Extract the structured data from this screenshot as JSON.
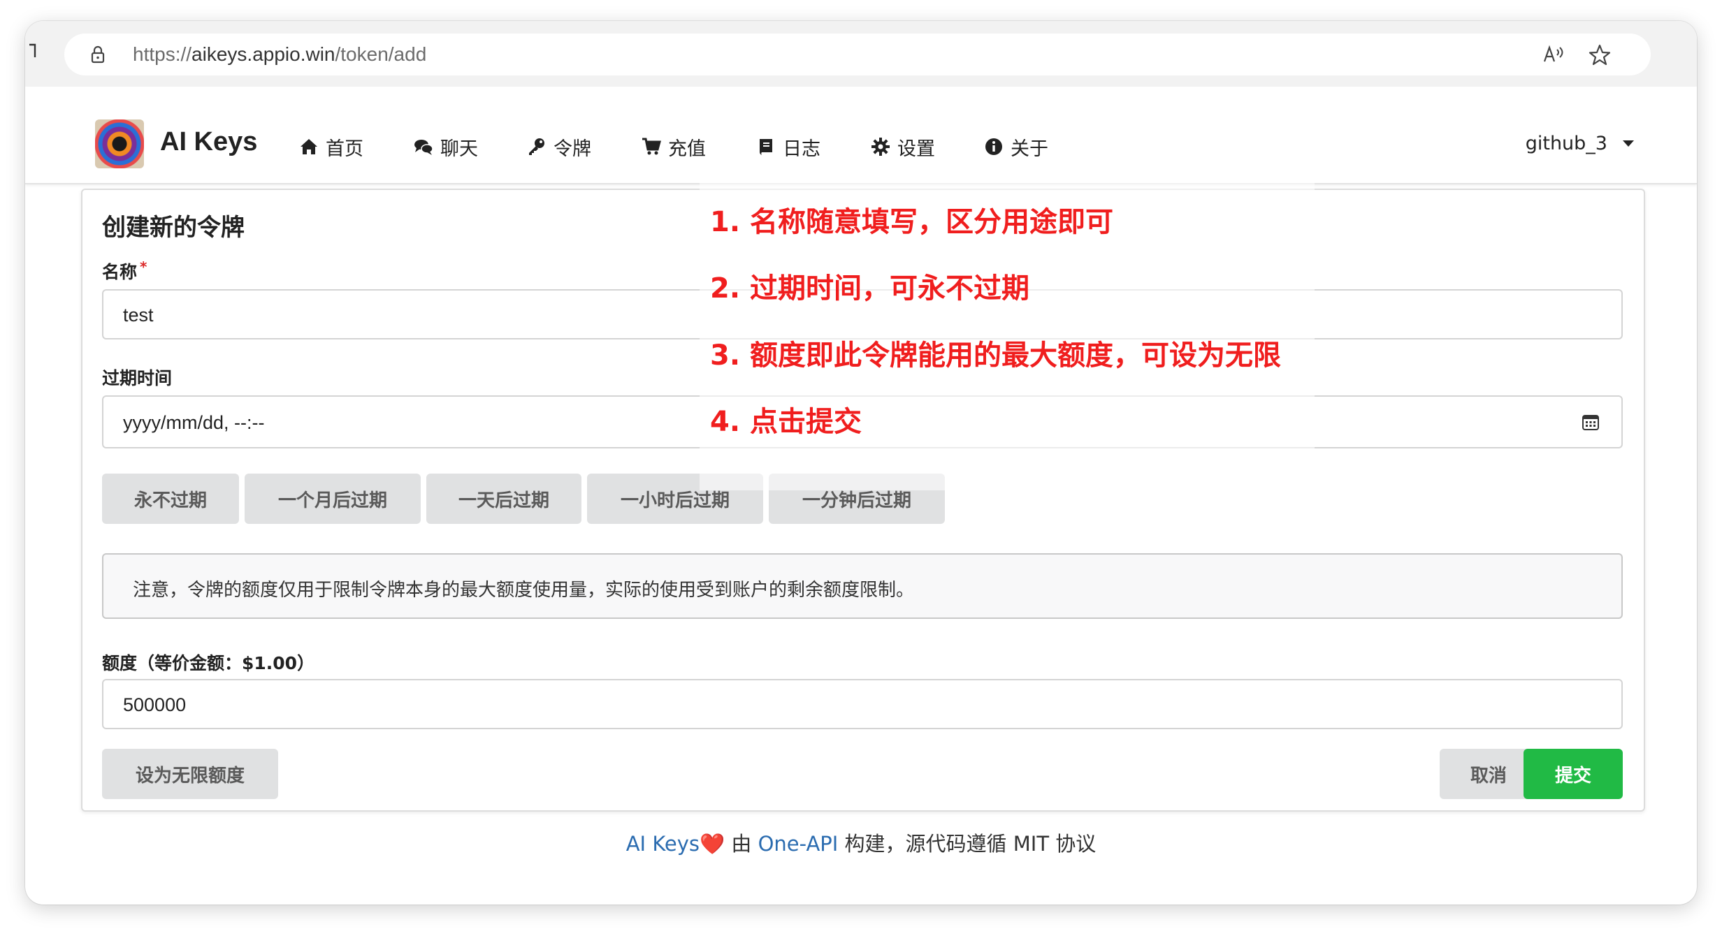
{
  "browser": {
    "url_prefix": "https://",
    "url_domain": "aikeys.appio.win",
    "url_path": "/token/add"
  },
  "nav": {
    "brand": "AI Keys",
    "items": [
      {
        "label": "首页",
        "icon": "home-icon"
      },
      {
        "label": "聊天",
        "icon": "comments-icon"
      },
      {
        "label": "令牌",
        "icon": "key-icon"
      },
      {
        "label": "充值",
        "icon": "cart-icon"
      },
      {
        "label": "日志",
        "icon": "book-icon"
      },
      {
        "label": "设置",
        "icon": "gear-icon"
      },
      {
        "label": "关于",
        "icon": "info-icon"
      }
    ],
    "user": "github_3"
  },
  "form": {
    "title": "创建新的令牌",
    "name_label": "名称",
    "required_mark": "*",
    "name_value": "test",
    "expire_label": "过期时间",
    "expire_value": "yyyy/mm/dd, --:--",
    "expire_buttons": [
      "永不过期",
      "一个月后过期",
      "一天后过期",
      "一小时后过期",
      "一分钟后过期"
    ],
    "notice": "注意，令牌的额度仅用于限制令牌本身的最大额度使用量，实际的使用受到账户的剩余额度限制。",
    "quota_label": "额度（等价金额：$1.00）",
    "quota_value": "500000",
    "unlimited_button": "设为无限额度",
    "cancel_button": "取消",
    "submit_button": "提交"
  },
  "footer": {
    "brand": "AI Keys",
    "heart": "❤️",
    "by": " 由 ",
    "project": "One-API",
    "rest": " 构建，源代码遵循 MIT 协议"
  },
  "annotations": [
    "1. 名称随意填写，区分用途即可",
    "2. 过期时间，可永不过期",
    "3. 额度即此令牌能用的最大额度，可设为无限",
    "4. 点击提交"
  ],
  "colors": {
    "annotation": "#f01e1e",
    "submit": "#21ba45",
    "link": "#2b6cb0"
  }
}
